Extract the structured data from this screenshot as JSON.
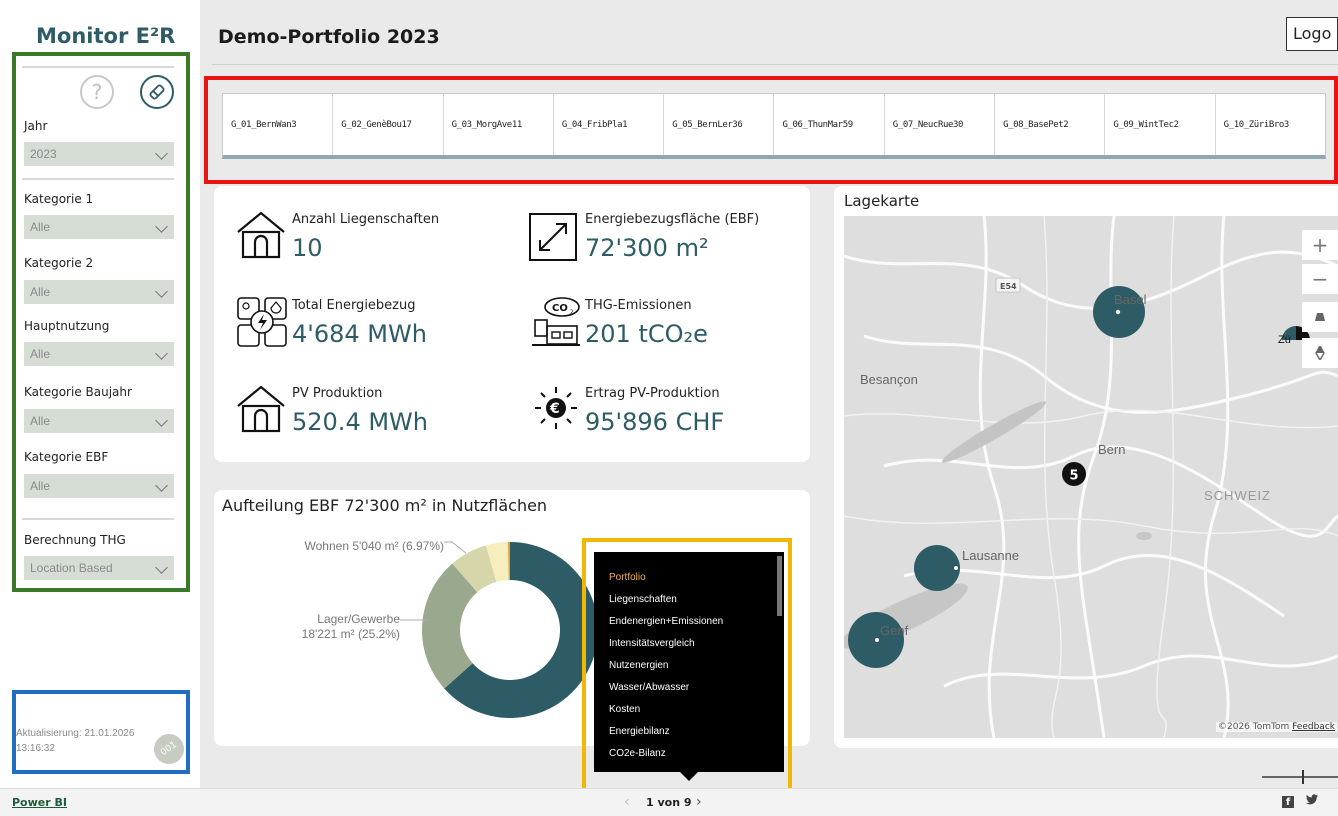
{
  "sidebar": {
    "app_title": "Monitor E²R",
    "filters": [
      {
        "label": "Jahr",
        "value": "2023"
      },
      {
        "label": "Kategorie 1",
        "value": "Alle"
      },
      {
        "label": "Kategorie 2",
        "value": "Alle"
      },
      {
        "label": "Hauptnutzung",
        "value": "Alle"
      },
      {
        "label": "Kategorie Baujahr",
        "value": "Alle"
      },
      {
        "label": "Kategorie EBF",
        "value": "Alle"
      },
      {
        "label": "Berechnung THG",
        "value": "Location Based"
      }
    ],
    "update_text": "Aktualisierung: 21.01.2026 13:16:32",
    "version_badge": "001"
  },
  "header": {
    "title": "Demo-Portfolio 2023",
    "logo": "Logo"
  },
  "property_tabs": [
    "G_01_BernWan3",
    "G_02_GenèBou17",
    "G_03_MorgAve11",
    "G_04_FribPla1",
    "G_05_BernLer36",
    "G_06_ThunMar59",
    "G_07_NeucRue30",
    "G_08_BasePet2",
    "G_09_WintTec2",
    "G_10_ZüriBro3"
  ],
  "kpis": {
    "anzahl": {
      "label": "Anzahl Liegenschaften",
      "value": "10"
    },
    "ebf": {
      "label": "Energiebezugsfläche (EBF)",
      "value": "72'300 m²"
    },
    "energie": {
      "label": "Total Energiebezug",
      "value": "4'684 MWh"
    },
    "thg": {
      "label": "THG-Emissionen",
      "value": "201 tCO₂e"
    },
    "pv": {
      "label": "PV Produktion",
      "value": "520.4 MWh"
    },
    "ertrag": {
      "label": "Ertrag PV-Produktion",
      "value": "95'896 CHF"
    }
  },
  "donut": {
    "title": "Aufteilung EBF 72'300 m² in Nutzflächen",
    "labels": {
      "wohnen": "Wohnen 5'040 m² (6.97%)",
      "lager_line1": "Lager/Gewerbe",
      "lager_line2": "18'221 m² (25.2%)"
    },
    "colors": {
      "main": "#2e5c66",
      "lager": "#9aa88d",
      "wohnen": "#d6d6aa",
      "other": "#f7eebd",
      "accent": "#e8a23c"
    }
  },
  "chart_data": {
    "type": "pie",
    "title": "Aufteilung EBF 72'300 m² in Nutzflächen",
    "categories": [
      "Lager/Gewerbe",
      "Wohnen"
    ],
    "values": [
      18221,
      5040
    ]
  },
  "map": {
    "title": "Lagekarte",
    "cities": [
      "Basel",
      "Besançon",
      "Bern",
      "Lausanne",
      "Genf",
      "SCHWEIZ",
      "Zü"
    ],
    "road_label": "E54",
    "cluster_count": "5",
    "attribution": "©2026 TomTom",
    "feedback": "Feedback",
    "zoom_in": "+",
    "zoom_out": "−"
  },
  "nav": {
    "pages": [
      "Portfolio",
      "Liegenschaften",
      "Endenergien+Emissionen",
      "Intensitätsvergleich",
      "Nutzenergien",
      "Wasser/Abwasser",
      "Kosten",
      "Energiebilanz",
      "CO2e-Bilanz"
    ],
    "indicator": "1 von 9",
    "prev": "‹",
    "next": "›"
  },
  "footer": {
    "powerbi": "Power BI"
  },
  "icons": {
    "help": "help-icon",
    "clear": "eraser-icon",
    "house": "house-icon",
    "expand": "expand-icon",
    "energy": "energy-icon",
    "co2": "co2-factory-icon",
    "sun": "sun-euro-icon"
  }
}
